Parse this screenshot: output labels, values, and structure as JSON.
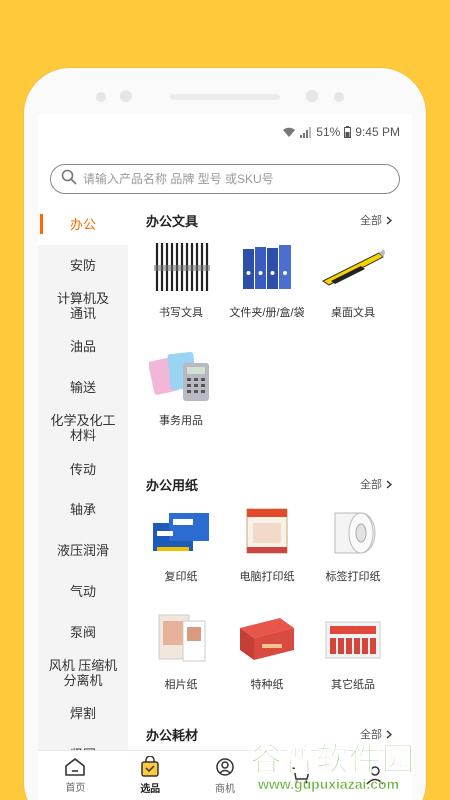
{
  "status": {
    "battery": "51%",
    "time": "9:45 PM"
  },
  "search": {
    "placeholder": "请输入产品名称 品牌 型号 或SKU号"
  },
  "sidebar": {
    "items": [
      {
        "label": "办公",
        "active": true
      },
      {
        "label": "安防"
      },
      {
        "label": "计算机及\n通讯"
      },
      {
        "label": "油品"
      },
      {
        "label": "输送"
      },
      {
        "label": "化学及化工\n材料"
      },
      {
        "label": "传动"
      },
      {
        "label": "轴承"
      },
      {
        "label": "液压润滑"
      },
      {
        "label": "气动"
      },
      {
        "label": "泵阀"
      },
      {
        "label": "风机 压缩机\n分离机"
      },
      {
        "label": "焊割"
      },
      {
        "label": "紧固"
      }
    ]
  },
  "sections": [
    {
      "title": "办公文具",
      "all_label": "全部",
      "items": [
        {
          "label": "书写文具",
          "icon": "pens-icon"
        },
        {
          "label": "文件夹/册/盒/袋",
          "icon": "binders-icon"
        },
        {
          "label": "桌面文具",
          "icon": "cutter-icon"
        },
        {
          "label": "事务用品",
          "icon": "calculator-icon"
        }
      ]
    },
    {
      "title": "办公用纸",
      "all_label": "全部",
      "items": [
        {
          "label": "复印纸",
          "icon": "copy-paper-icon"
        },
        {
          "label": "电脑打印纸",
          "icon": "printer-paper-icon"
        },
        {
          "label": "标签打印纸",
          "icon": "label-roll-icon"
        },
        {
          "label": "相片纸",
          "icon": "photo-paper-icon"
        },
        {
          "label": "特种纸",
          "icon": "special-paper-icon"
        },
        {
          "label": "其它纸品",
          "icon": "other-paper-icon"
        }
      ]
    },
    {
      "title": "办公耗材",
      "all_label": "全部",
      "items": []
    }
  ],
  "tabbar": {
    "items": [
      {
        "label": "首页",
        "icon": "home-icon"
      },
      {
        "label": "选品",
        "icon": "bag-icon",
        "active": true
      },
      {
        "label": "商机",
        "icon": "opportunity-icon"
      },
      {
        "label": "",
        "icon": "cart-icon"
      },
      {
        "label": "",
        "icon": "user-icon"
      }
    ]
  },
  "watermark": {
    "title": "谷普软件园",
    "url": "www.gupuxiazai.com"
  },
  "colors": {
    "accent": "#FF6A00",
    "background": "#FFC93C",
    "watermark": "#6CB33F"
  }
}
